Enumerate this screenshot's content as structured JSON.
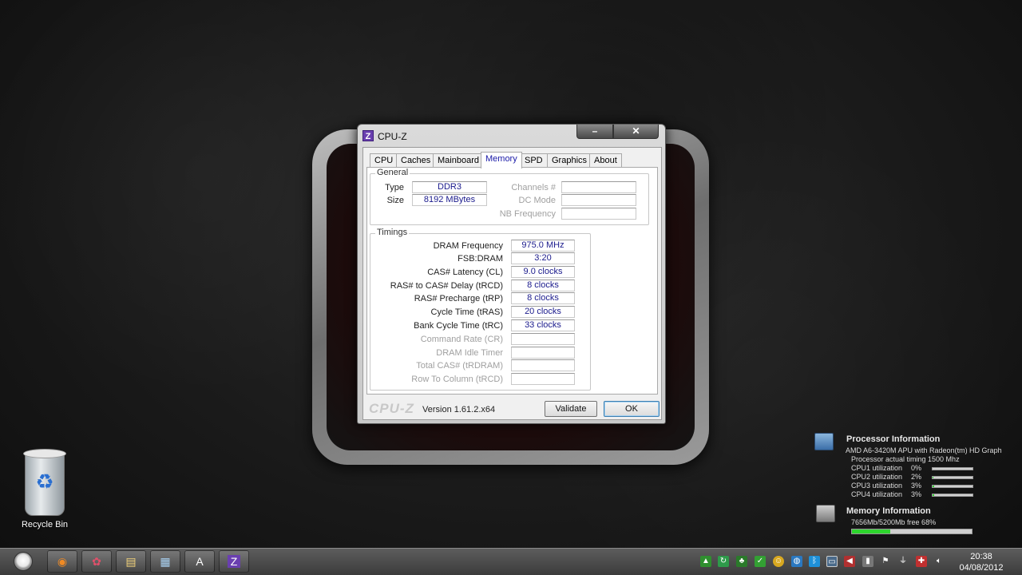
{
  "window": {
    "title": "CPU-Z",
    "app_icon": "Z",
    "minimize_label": "–",
    "close_label": "✕"
  },
  "tabs": [
    {
      "label": "CPU"
    },
    {
      "label": "Caches"
    },
    {
      "label": "Mainboard"
    },
    {
      "label": "Memory",
      "active": true
    },
    {
      "label": "SPD"
    },
    {
      "label": "Graphics"
    },
    {
      "label": "About"
    }
  ],
  "general": {
    "title": "General",
    "type_label": "Type",
    "type_value": "DDR3",
    "size_label": "Size",
    "size_value": "8192 MBytes",
    "channels_label": "Channels #",
    "channels_value": "",
    "dc_mode_label": "DC Mode",
    "dc_mode_value": "",
    "nb_freq_label": "NB Frequency",
    "nb_freq_value": ""
  },
  "timings": {
    "title": "Timings",
    "rows": [
      {
        "label": "DRAM Frequency",
        "value": "975.0 MHz"
      },
      {
        "label": "FSB:DRAM",
        "value": "3:20"
      },
      {
        "label": "CAS# Latency (CL)",
        "value": "9.0 clocks"
      },
      {
        "label": "RAS# to CAS# Delay (tRCD)",
        "value": "8 clocks"
      },
      {
        "label": "RAS# Precharge (tRP)",
        "value": "8 clocks"
      },
      {
        "label": "Cycle Time (tRAS)",
        "value": "20 clocks"
      },
      {
        "label": "Bank Cycle Time (tRC)",
        "value": "33 clocks"
      },
      {
        "label": "Command Rate (CR)",
        "value": ""
      },
      {
        "label": "DRAM Idle Timer",
        "value": ""
      },
      {
        "label": "Total CAS# (tRDRAM)",
        "value": ""
      },
      {
        "label": "Row To Column (tRCD)",
        "value": ""
      }
    ]
  },
  "footer": {
    "logo": "CPU-Z",
    "version": "Version 1.61.2.x64",
    "validate_label": "Validate",
    "ok_label": "OK"
  },
  "desktop": {
    "recycle_bin_label": "Recycle Bin"
  },
  "processor_gadget": {
    "title": "Processor Information",
    "model": "AMD A6-3420M APU with Radeon(tm) HD Graph",
    "timing": "Processor actual timing 1500 Mhz",
    "cpus": [
      {
        "label": "CPU1 utilization",
        "value": "0%",
        "percent": 0
      },
      {
        "label": "CPU2 utilization",
        "value": "2%",
        "percent": 2
      },
      {
        "label": "CPU3 utilization",
        "value": "3%",
        "percent": 3
      },
      {
        "label": "CPU4 utilization",
        "value": "3%",
        "percent": 3
      }
    ]
  },
  "memory_gadget": {
    "title": "Memory Information",
    "usage": "7656Mb/5200Mb  free 68%",
    "used_percent": 32,
    "bar_color": "#2dd52d"
  },
  "taskbar": {
    "time": "20:38",
    "date": "04/08/2012",
    "pinned": [
      {
        "name": "firefox-icon",
        "glyph": "◉"
      },
      {
        "name": "app-flower-icon",
        "glyph": "✿"
      },
      {
        "name": "explorer-icon",
        "glyph": "▤"
      },
      {
        "name": "notepad-icon",
        "glyph": "▦"
      },
      {
        "name": "font-app-icon",
        "glyph": "A"
      },
      {
        "name": "cpuz-icon",
        "glyph": "Z"
      }
    ]
  }
}
